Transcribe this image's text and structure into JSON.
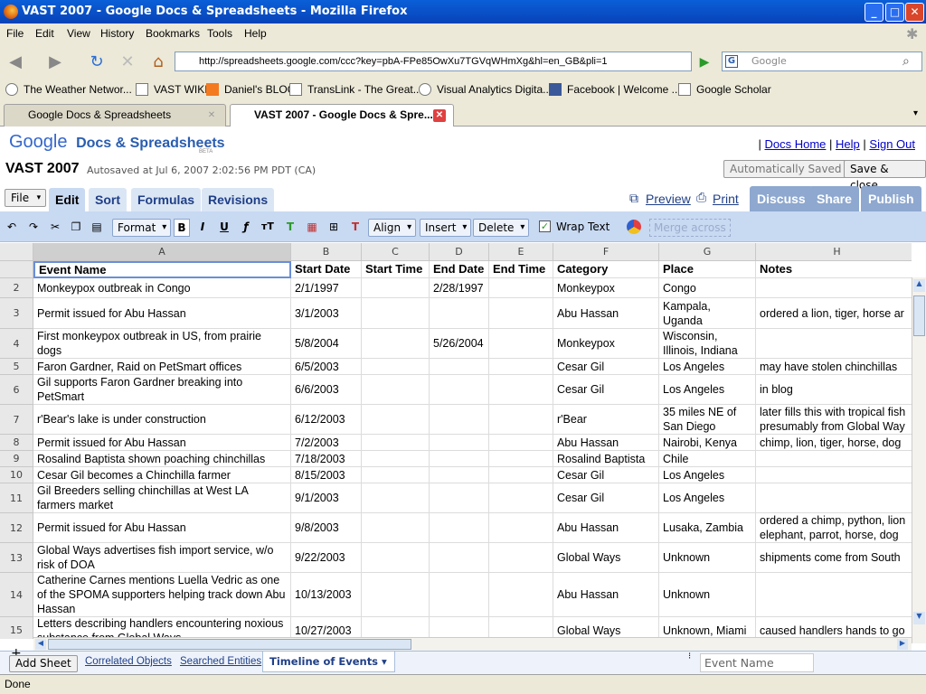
{
  "window": {
    "title": "VAST 2007 - Google Docs & Spreadsheets - Mozilla Firefox",
    "min": "_",
    "max": "□",
    "close": "✕"
  },
  "menu": [
    "File",
    "Edit",
    "View",
    "History",
    "Bookmarks",
    "Tools",
    "Help"
  ],
  "nav": {
    "url": "http://spreadsheets.google.com/ccc?key=pbA-FPe85OwXu7TGVqWHmXg&hl=en_GB&pli=1",
    "search_placeholder": "Google"
  },
  "bookmarks": [
    "The Weather Networ...",
    "VAST WIKI",
    "Daniel's BLOG",
    "TransLink - The Great...",
    "Visual Analytics Digita...",
    "Facebook | Welcome ...",
    "Google Scholar"
  ],
  "tabs": [
    {
      "label": "Google Docs & Spreadsheets"
    },
    {
      "label": "VAST 2007 - Google Docs & Spre..."
    }
  ],
  "app": {
    "logo_google": "Google",
    "logo_product": "Docs & Spreadsheets",
    "logo_beta": "BETA",
    "links": [
      "Docs Home",
      "Help",
      "Sign Out"
    ],
    "doc_title": "VAST 2007",
    "autosaved": "Autosaved at Jul 6, 2007 2:02:56 PM PDT (CA)",
    "auto_saved_btn": "Automatically Saved",
    "save_close_btn": "Save & close",
    "file_menu": "File",
    "tabs": [
      "Edit",
      "Sort",
      "Formulas",
      "Revisions"
    ],
    "preview": "Preview",
    "print": "Print",
    "actions": [
      "Discuss",
      "Share",
      "Publish"
    ]
  },
  "toolbar": {
    "format": "Format",
    "align": "Align",
    "insert": "Insert",
    "delete": "Delete",
    "wrap_text": "Wrap Text",
    "wrap_checked": true,
    "merge": "Merge across"
  },
  "grid": {
    "col_letters": [
      "A",
      "B",
      "C",
      "D",
      "E",
      "F",
      "G",
      "H"
    ],
    "header_row": [
      "Event Name",
      "Start Date",
      "Start Time",
      "End Date",
      "End Time",
      "Category",
      "Place",
      "Notes"
    ],
    "rows": [
      {
        "n": "2",
        "cells": [
          "Monkeypox outbreak in Congo",
          "2/1/1997",
          "",
          "2/28/1997",
          "",
          "Monkeypox",
          "Congo",
          ""
        ]
      },
      {
        "n": "3",
        "cells": [
          "Permit issued for Abu Hassan",
          "3/1/2003",
          "",
          "",
          "",
          "Abu Hassan",
          "Kampala, Uganda",
          "ordered a lion, tiger, horse ar"
        ]
      },
      {
        "n": "4",
        "cells": [
          "First monkeypox outbreak in US, from prairie dogs",
          "5/8/2004",
          "",
          "5/26/2004",
          "",
          "Monkeypox",
          "Wisconsin, Illinois, Indiana",
          ""
        ]
      },
      {
        "n": "5",
        "cells": [
          "Faron Gardner, Raid on PetSmart offices",
          "6/5/2003",
          "",
          "",
          "",
          "Cesar Gil",
          "Los Angeles",
          "may have stolen chinchillas"
        ]
      },
      {
        "n": "6",
        "cells": [
          "Gil supports Faron Gardner breaking into PetSmart",
          "6/6/2003",
          "",
          "",
          "",
          "Cesar Gil",
          "Los Angeles",
          "in blog"
        ]
      },
      {
        "n": "7",
        "cells": [
          "r'Bear's lake is under construction",
          "6/12/2003",
          "",
          "",
          "",
          "r'Bear",
          "35 miles NE of San Diego",
          "later fills this with tropical fish presumably from Global Way"
        ]
      },
      {
        "n": "8",
        "cells": [
          "Permit issued for Abu Hassan",
          "7/2/2003",
          "",
          "",
          "",
          "Abu Hassan",
          "Nairobi, Kenya",
          "chimp, lion, tiger, horse, dog"
        ]
      },
      {
        "n": "9",
        "cells": [
          "Rosalind Baptista shown poaching chinchillas",
          "7/18/2003",
          "",
          "",
          "",
          "Rosalind Baptista",
          "Chile",
          ""
        ]
      },
      {
        "n": "10",
        "cells": [
          "Cesar Gil becomes a Chinchilla farmer",
          "8/15/2003",
          "",
          "",
          "",
          "Cesar Gil",
          "Los Angeles",
          ""
        ]
      },
      {
        "n": "11",
        "cells": [
          "Gil Breeders selling chinchillas at West LA farmers market",
          "9/1/2003",
          "",
          "",
          "",
          "Cesar Gil",
          "Los Angeles",
          ""
        ]
      },
      {
        "n": "12",
        "cells": [
          "Permit issued for Abu Hassan",
          "9/8/2003",
          "",
          "",
          "",
          "Abu Hassan",
          "Lusaka, Zambia",
          "ordered a chimp, python, lion elephant, parrot, horse, dog"
        ]
      },
      {
        "n": "13",
        "cells": [
          "Global Ways advertises fish import service, w/o risk of DOA",
          "9/22/2003",
          "",
          "",
          "",
          "Global Ways",
          "Unknown",
          "shipments come from South"
        ]
      },
      {
        "n": "14",
        "cells": [
          "Catherine Carnes mentions Luella Vedric as one of the SPOMA supporters helping track down Abu Hassan",
          "10/13/2003",
          "",
          "",
          "",
          "Abu Hassan",
          "Unknown",
          ""
        ]
      },
      {
        "n": "15",
        "cells": [
          "Letters describing handlers encountering noxious substance from Global Ways",
          "10/27/2003",
          "",
          "",
          "",
          "Global Ways",
          "Unknown, Miami",
          "caused handlers hands to go"
        ]
      }
    ]
  },
  "sheetbar": {
    "add_sheet": "Add Sheet",
    "sheets": [
      "Correlated Objects",
      "Searched Entities",
      "Timeline of Events"
    ],
    "cell_ref": "Event Name"
  },
  "status": "Done"
}
